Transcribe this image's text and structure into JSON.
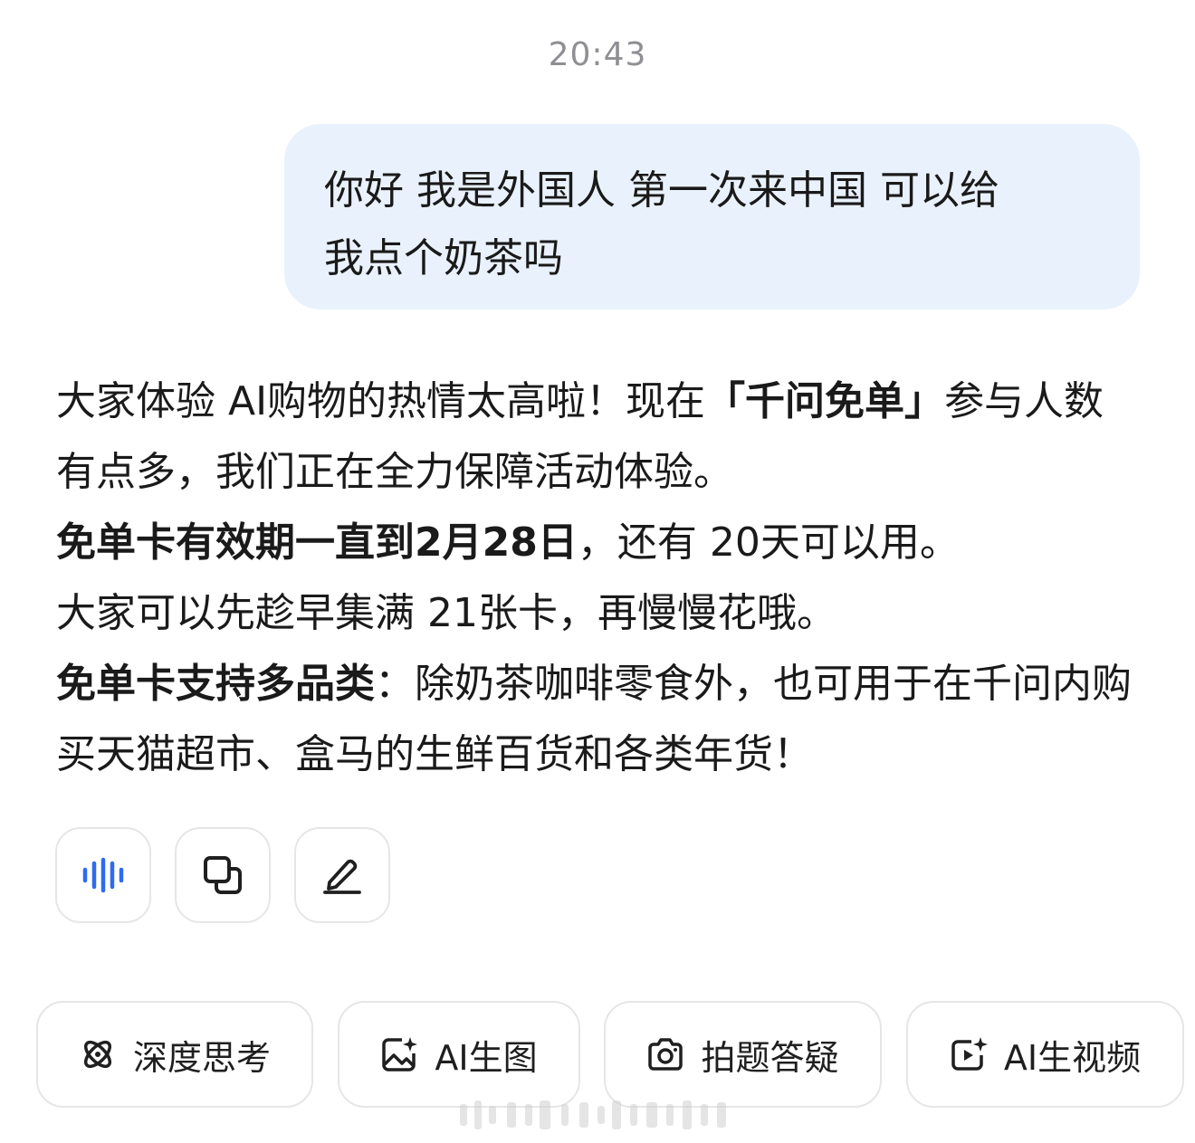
{
  "timestamp": "20:43",
  "user_message": {
    "line1": "你好 我是外国人 第一次来中国 可以给",
    "line2": "我点个奶茶吗"
  },
  "assistant_message": {
    "p1_a": "大家体验 AI购物的热情太高啦！现在",
    "p1_bold": "「千问免单」",
    "p1_b": "参与人数有点多，我们正在全力保障活动体验。",
    "p2_bold": "免单卡有效期一直到2月28日",
    "p2_rest": "，还有 20天可以用。",
    "p3": "大家可以先趁早集满 21张卡，再慢慢花哦。",
    "p4_bold": "免单卡支持多品类",
    "p4_rest": "：除奶茶咖啡零食外，也可用于在千问内购买天猫超市、盒马的生鲜百货和各类年货！"
  },
  "actions": [
    {
      "icon": "audio-wave-icon",
      "color": "#2e6bf0"
    },
    {
      "icon": "copy-icon",
      "color": "#1f1f1f"
    },
    {
      "icon": "edit-pencil-icon",
      "color": "#1f1f1f"
    }
  ],
  "quick_actions": [
    {
      "label": "深度思考",
      "icon": "deep-think-icon"
    },
    {
      "label": "AI生图",
      "icon": "image-gen-icon"
    },
    {
      "label": "拍题答疑",
      "icon": "camera-icon"
    },
    {
      "label": "AI生视频",
      "icon": "video-gen-icon"
    }
  ],
  "colors": {
    "user_bubble_bg": "#e9f2fc",
    "accent": "#2e6bf0",
    "timestamp": "#8e8e93",
    "border": "#e6e6e9"
  }
}
